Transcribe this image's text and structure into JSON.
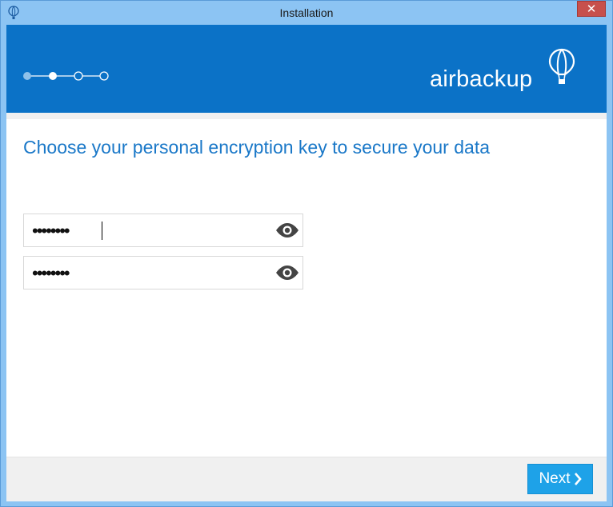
{
  "window": {
    "title": "Installation",
    "close_glyph": "✕"
  },
  "header": {
    "brand": "airbackup",
    "steps": {
      "current": 2,
      "total": 4
    }
  },
  "main": {
    "heading": "Choose your personal encryption key to secure your data",
    "password_field": {
      "masked_value": "••••••••",
      "icon": "eye-icon"
    },
    "confirm_field": {
      "masked_value": "••••••••",
      "icon": "eye-icon"
    }
  },
  "footer": {
    "next_label": "Next",
    "next_icon": "chevron-right-icon"
  },
  "colors": {
    "header_bg": "#0b72c7",
    "heading_text": "#1a78c8",
    "button_bg": "#1ea2e8",
    "close_bg": "#c7504c"
  }
}
